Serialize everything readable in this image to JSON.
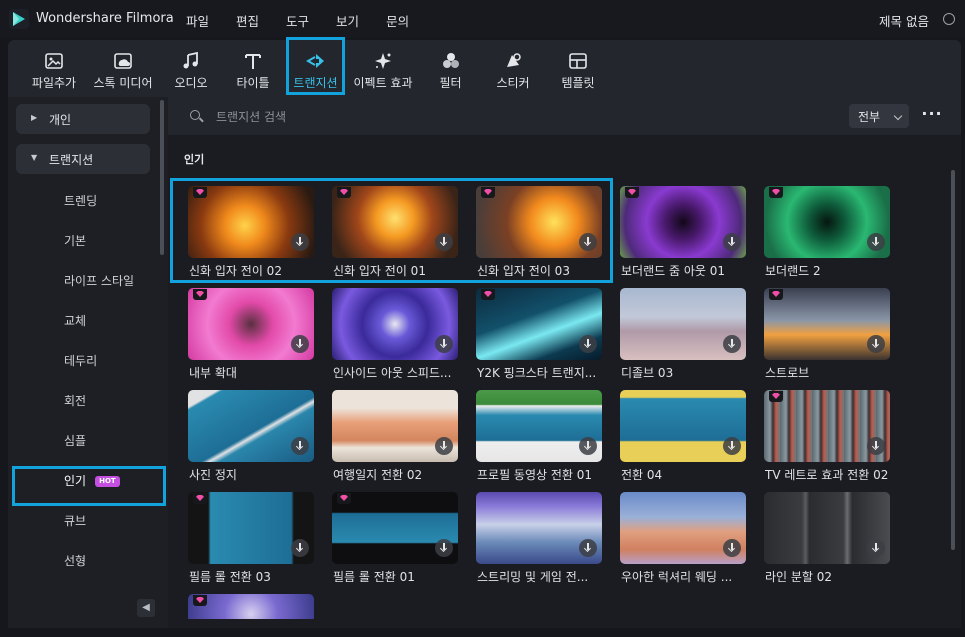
{
  "app": {
    "name": "Wondershare Filmora",
    "project_name": "제목 없음"
  },
  "menu": [
    "파일",
    "편집",
    "도구",
    "보기",
    "문의"
  ],
  "toolbar": [
    {
      "label": "파일추가",
      "icon": "import-icon"
    },
    {
      "label": "스톡 미디어",
      "icon": "stock-media-icon"
    },
    {
      "label": "오디오",
      "icon": "music-note-icon"
    },
    {
      "label": "타이틀",
      "icon": "title-t-icon"
    },
    {
      "label": "트랜지션",
      "icon": "transition-icon",
      "active": true
    },
    {
      "label": "이펙트 효과",
      "icon": "effects-sparkle-icon"
    },
    {
      "label": "필터",
      "icon": "filter-circles-icon"
    },
    {
      "label": "스티커",
      "icon": "sticker-icon"
    },
    {
      "label": "템플릿",
      "icon": "template-icon"
    }
  ],
  "sidebar": {
    "groups": [
      {
        "label": "개인",
        "expanded": false
      },
      {
        "label": "트랜지션",
        "expanded": true
      }
    ],
    "items": [
      "트렌딩",
      "기본",
      "라이프 스타일",
      "교체",
      "테두리",
      "회전",
      "심플",
      "인기",
      "큐브",
      "선형"
    ],
    "selected": "인기",
    "hot_badge": "HOT"
  },
  "search": {
    "placeholder": "트랜지션 검색",
    "filter_label": "전부"
  },
  "section_title": "인기",
  "cards": [
    {
      "name": "신화 입자 전이 02",
      "premium": true
    },
    {
      "name": "신화 입자 전이 01",
      "premium": true
    },
    {
      "name": "신화 입자 전이 03",
      "premium": true
    },
    {
      "name": "보더랜드 줌 아웃 01",
      "premium": true
    },
    {
      "name": "보더랜드 2",
      "premium": true
    },
    {
      "name": "내부 확대",
      "premium": true
    },
    {
      "name": "인사이드 아웃 스피드...",
      "premium": false
    },
    {
      "name": "Y2K 핑크스타 트랜지...",
      "premium": true
    },
    {
      "name": "디졸브 03",
      "premium": false
    },
    {
      "name": "스트로브",
      "premium": true
    },
    {
      "name": "사진 정지",
      "premium": false
    },
    {
      "name": "여행일지 전환 02",
      "premium": false
    },
    {
      "name": "프로필 동영상 전환 01",
      "premium": false
    },
    {
      "name": "전환 04",
      "premium": false
    },
    {
      "name": "TV 레트로 효과 전환 02",
      "premium": true
    },
    {
      "name": "필름 롤 전환 03",
      "premium": true
    },
    {
      "name": "필름 롤 전환 01",
      "premium": true
    },
    {
      "name": "스트리밍 및 게임 전...",
      "premium": false
    },
    {
      "name": "우아한 럭셔리 웨딩 ...",
      "premium": false
    },
    {
      "name": "라인 분할 02",
      "premium": false
    },
    {
      "name": "",
      "premium": true
    }
  ],
  "colors": {
    "accent": "#12a3dc",
    "active_tab": "#38c0e8",
    "premium_gem": "#ef4fa6",
    "hot_badge": "#c44fe0"
  }
}
